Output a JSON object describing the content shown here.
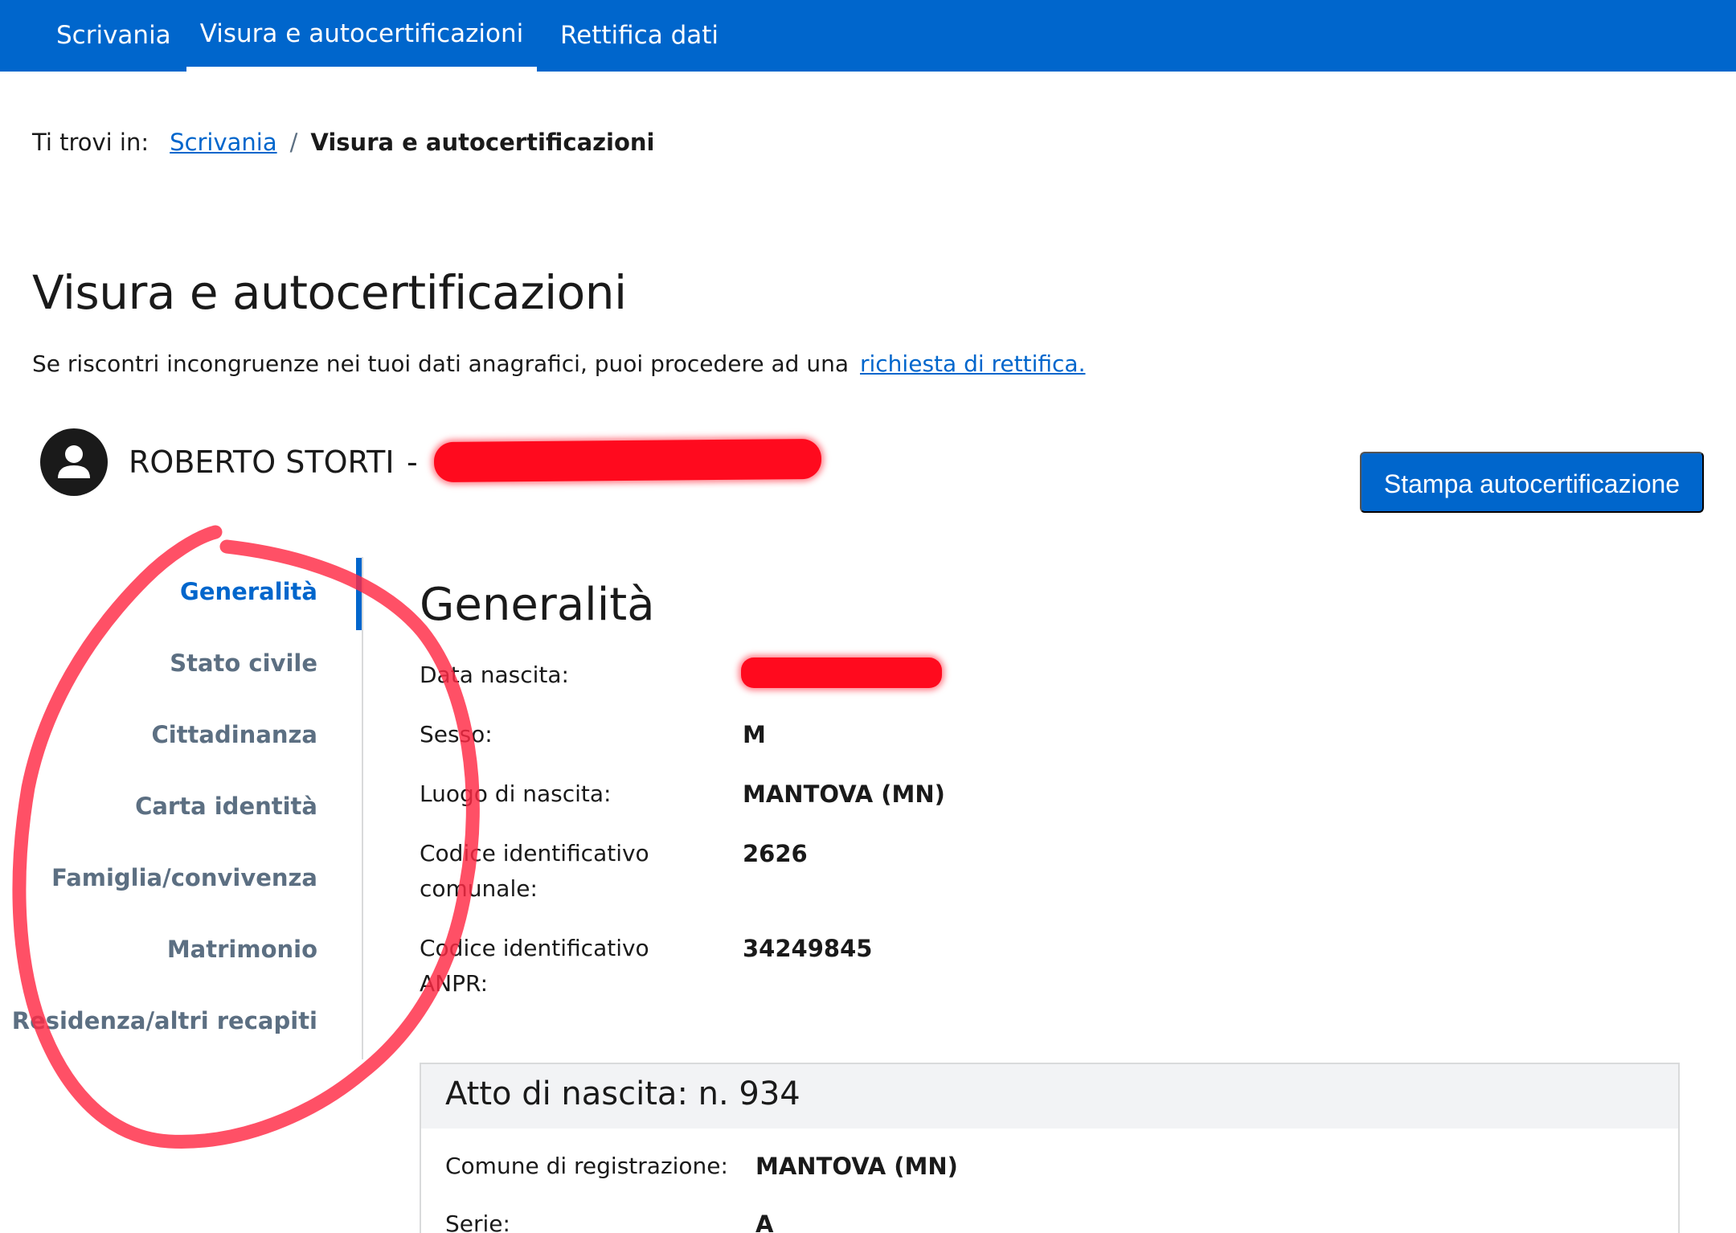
{
  "topnav": {
    "tabs": [
      {
        "label": "Scrivania",
        "active": false
      },
      {
        "label": "Visura e autocertificazioni",
        "active": true
      },
      {
        "label": "Rettifica dati",
        "active": false
      }
    ]
  },
  "breadcrumb": {
    "prefix": "Ti trovi in:",
    "link": "Scrivania",
    "separator": "/",
    "current": "Visura e autocertificazioni"
  },
  "page": {
    "title": "Visura e autocertificazioni",
    "intro_text": "Se riscontri incongruenze nei tuoi dati anagrafici, puoi procedere ad una",
    "intro_link": "richiesta di rettifica."
  },
  "user": {
    "name": "ROBERTO STORTI",
    "dash": "-"
  },
  "actions": {
    "print_label": "Stampa autocertificazione"
  },
  "sidenav": {
    "items": [
      {
        "label": "Generalità",
        "active": true
      },
      {
        "label": "Stato civile",
        "active": false
      },
      {
        "label": "Cittadinanza",
        "active": false
      },
      {
        "label": "Carta identità",
        "active": false
      },
      {
        "label": "Famiglia/convivenza",
        "active": false
      },
      {
        "label": "Matrimonio",
        "active": false
      },
      {
        "label": "Residenza/altri recapiti",
        "active": false
      }
    ]
  },
  "generalita": {
    "title": "Generalità",
    "fields": [
      {
        "label": "Data nascita:",
        "value": ""
      },
      {
        "label": "Sesso:",
        "value": "M"
      },
      {
        "label": "Luogo di nascita:",
        "value": "MANTOVA (MN)"
      },
      {
        "label": "Codice identificativo comunale:",
        "value": "2626"
      },
      {
        "label": "Codice identificativo ANPR:",
        "value": "34249845"
      }
    ]
  },
  "atto": {
    "title": "Atto di nascita: n. 934",
    "fields": [
      {
        "label": "Comune di registrazione:",
        "value": "MANTOVA (MN)"
      },
      {
        "label": "Serie:",
        "value": "A"
      }
    ]
  },
  "colors": {
    "brand": "#0066cc",
    "sidenav_text": "#5c6f82",
    "annotation": "#ff2a44",
    "redaction": "#ff0a1e"
  }
}
